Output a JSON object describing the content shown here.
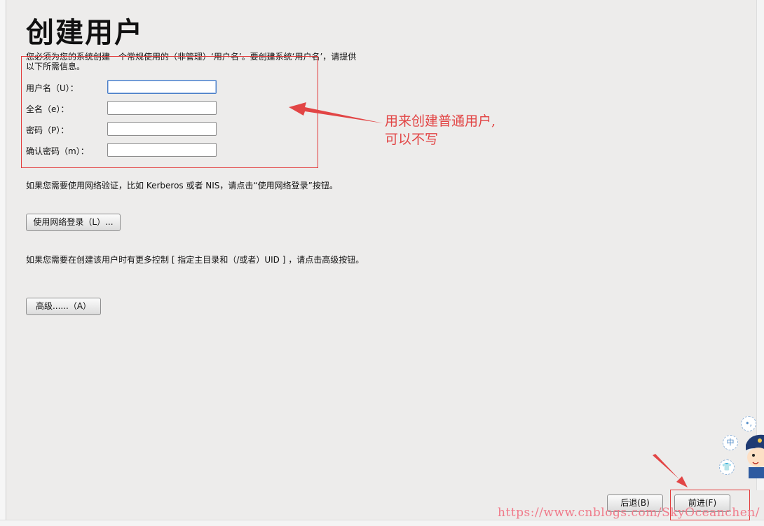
{
  "page": {
    "title": "创建用户",
    "intro": "您必须为您的系统创建一个常规使用的（非管理）‘用户名’。要创建系统‘用户名’，请提供以下所需信息。"
  },
  "form": {
    "username_label": "用户名（U）：",
    "fullname_label": "全名（e）：",
    "password_label": "密码（P）：",
    "confirm_label": "确认密码（m）：",
    "username_value": "",
    "fullname_value": "",
    "password_value": "",
    "confirm_value": ""
  },
  "network": {
    "note": "如果您需要使用网络验证，比如 Kerberos 或者 NIS，请点击“使用网络登录”按钮。",
    "button_label": "使用网络登录（L）..."
  },
  "advanced": {
    "note": "如果您需要在创建该用户时有更多控制 [ 指定主目录和（/或者）UID ] ，请点击高级按钮。",
    "button_label": "高级......（A）"
  },
  "nav": {
    "back_label": "后退(B)",
    "next_label": "前进(F)"
  },
  "annotation": {
    "line1": "用来创建普通用户,",
    "line2": "可以不写"
  },
  "watermark": "https://www.cnblogs.com/SkyOceanchen/",
  "widget": {
    "badge1": "中",
    "badge2": "•,",
    "badge3": "👕"
  },
  "colors": {
    "annotation_red": "#e24545",
    "focus_blue": "#4a7ec8",
    "background": "#edeceb"
  }
}
